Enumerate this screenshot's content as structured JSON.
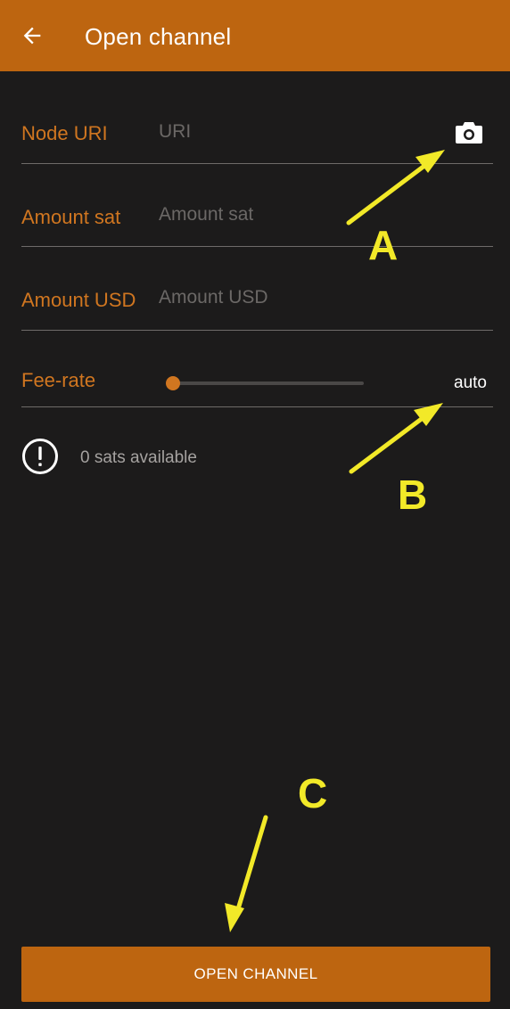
{
  "appbar": {
    "title": "Open channel",
    "back_icon": "arrow-left-icon",
    "color": "#bd6510"
  },
  "form": {
    "node_uri": {
      "label": "Node URI",
      "value": "",
      "placeholder": "URI",
      "scan_icon": "camera-icon"
    },
    "amount_sat": {
      "label": "Amount sat",
      "value": "",
      "placeholder": "Amount sat"
    },
    "amount_usd": {
      "label": "Amount USD",
      "value": "",
      "placeholder": "Amount USD"
    },
    "fee_rate": {
      "label": "Fee-rate",
      "slider_level": 0.0,
      "value_label": "auto"
    }
  },
  "info": {
    "icon": "exclamation-circle-icon",
    "text": "0 sats available"
  },
  "primary_button": {
    "label": "OPEN CHANNEL"
  },
  "annotations": {
    "color": "#f2e928",
    "labels": [
      "A",
      "B",
      "C"
    ]
  },
  "colors": {
    "background": "#1c1b1b",
    "accent": "#bd6510",
    "label": "#d07620",
    "divider": "#6e6b69"
  }
}
